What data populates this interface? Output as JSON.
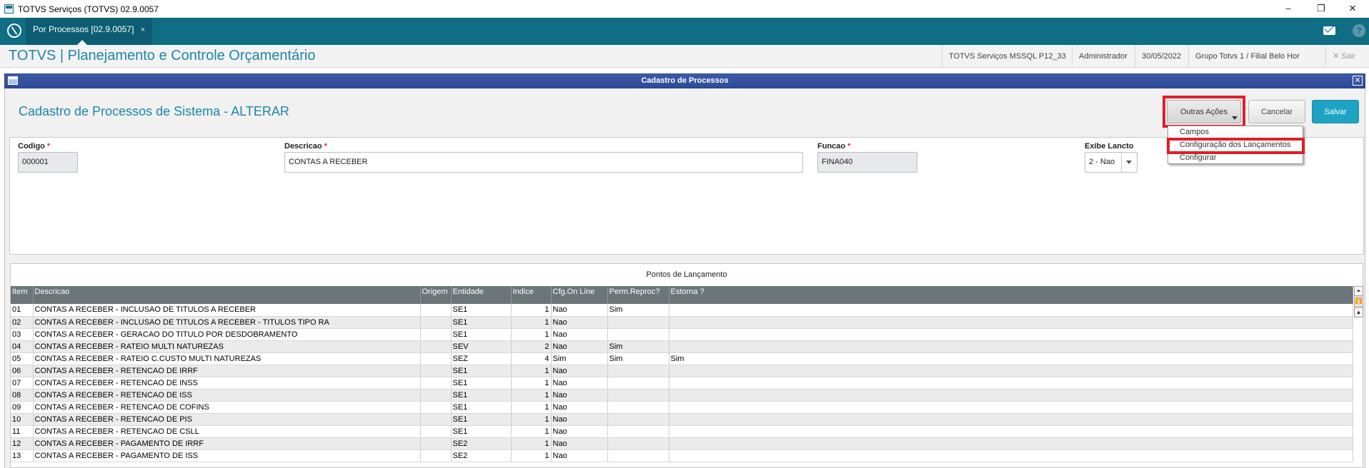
{
  "window": {
    "title": "TOTVS Serviços (TOTVS) 02.9.0057",
    "minimize": "–",
    "restore": "❐",
    "close": "✕"
  },
  "tabbar": {
    "active_tab": "Por Processos [02.9.0057]",
    "tab_close": "×",
    "help": "?"
  },
  "header": {
    "app_title": "TOTVS | Planejamento e Controle Orçamentário",
    "environment": "TOTVS Serviços MSSQL P12_33",
    "user": "Administrador",
    "date": "30/05/2022",
    "company": "Grupo Totvs 1 / Filial Belo Hor",
    "exit_label": "✕  Sair"
  },
  "dialog": {
    "title": "Cadastro de Processos",
    "close": "✕",
    "form_title": "Cadastro de Processos de Sistema - ALTERAR",
    "buttons": {
      "more_actions": "Outras Ações",
      "cancel": "Cancelar",
      "save": "Salvar"
    },
    "menu": {
      "items": [
        "Campos",
        "Configuração dos Lançamentos",
        "Configurar"
      ]
    },
    "fields": {
      "codigo_label": "Codigo",
      "codigo_value": "000001",
      "descricao_label": "Descricao",
      "descricao_value": "CONTAS A RECEBER",
      "funcao_label": "Funcao",
      "funcao_value": "FINA040",
      "exibe_label": "Exibe Lancto",
      "exibe_value": "2 - Nao",
      "required_mark": "*"
    },
    "grid": {
      "caption": "Pontos de Lançamento",
      "columns": [
        "Item",
        "Descricao",
        "Origem",
        "Entidade",
        "Indice",
        "Cfg.On Line",
        "Perm.Reproc?",
        "Estorna ?"
      ],
      "rows": [
        [
          "01",
          "CONTAS A RECEBER - INCLUSAO DE TITULOS A RECEBER",
          "",
          "SE1",
          "1",
          "Nao",
          "Sim",
          ""
        ],
        [
          "02",
          "CONTAS A RECEBER - INCLUSAO DE TITULOS A RECEBER - TITULOS TIPO RA",
          "",
          "SE1",
          "1",
          "Nao",
          "",
          ""
        ],
        [
          "03",
          "CONTAS A RECEBER - GERACAO DO TITULO POR DESDOBRAMENTO",
          "",
          "SE1",
          "1",
          "Nao",
          "",
          ""
        ],
        [
          "04",
          "CONTAS A RECEBER - RATEIO MULTI NATUREZAS",
          "",
          "SEV",
          "2",
          "Nao",
          "Sim",
          ""
        ],
        [
          "05",
          "CONTAS A RECEBER - RATEIO C.CUSTO MULTI NATUREZAS",
          "",
          "SEZ",
          "4",
          "Sim",
          "Sim",
          "Sim"
        ],
        [
          "06",
          "CONTAS A RECEBER - RETENCAO DE IRRF",
          "",
          "SE1",
          "1",
          "Nao",
          "",
          ""
        ],
        [
          "07",
          "CONTAS A RECEBER - RETENCAO DE INSS",
          "",
          "SE1",
          "1",
          "Nao",
          "",
          ""
        ],
        [
          "08",
          "CONTAS A RECEBER - RETENCAO DE ISS",
          "",
          "SE1",
          "1",
          "Nao",
          "",
          ""
        ],
        [
          "09",
          "CONTAS A RECEBER - RETENCAO DE COFINS",
          "",
          "SE1",
          "1",
          "Nao",
          "",
          ""
        ],
        [
          "10",
          "CONTAS A RECEBER - RETENCAO DE PIS",
          "",
          "SE1",
          "1",
          "Nao",
          "",
          ""
        ],
        [
          "11",
          "CONTAS A RECEBER - RETENCAO DE CSLL",
          "",
          "SE1",
          "1",
          "Nao",
          "",
          ""
        ],
        [
          "12",
          "CONTAS A RECEBER - PAGAMENTO DE IRRF",
          "",
          "SE2",
          "1",
          "Nao",
          "",
          ""
        ],
        [
          "13",
          "CONTAS A RECEBER - PAGAMENTO DE ISS",
          "",
          "SE2",
          "1",
          "Nao",
          "",
          ""
        ]
      ],
      "scroll_buttons": [
        "⏶",
        "⏫",
        "▲"
      ]
    },
    "highlight_color": "#e01e2b",
    "accent_color": "#1e86a8",
    "save_color": "#1fa3c4"
  }
}
